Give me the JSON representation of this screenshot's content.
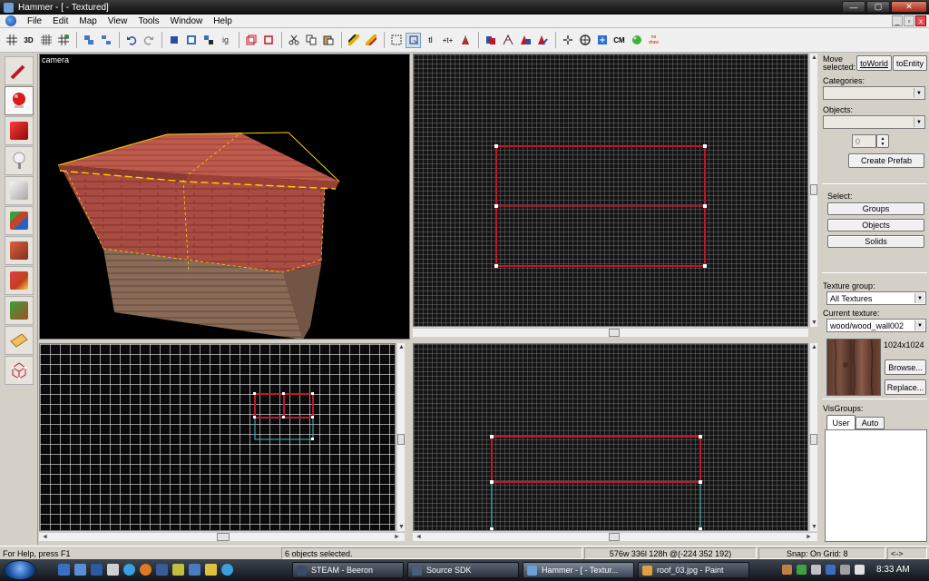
{
  "window": {
    "title": "Hammer - [ - Textured]"
  },
  "menu": [
    "File",
    "Edit",
    "Map",
    "View",
    "Tools",
    "Window",
    "Help"
  ],
  "mdi_buttons": {
    "minimize": "_",
    "restore": "▫",
    "close": "x"
  },
  "toolbar": {
    "label_3d": "3D",
    "label_tl": "tl",
    "label_cm": "CM",
    "label_no_draw": "no draw"
  },
  "viewports": {
    "camera_label": "camera"
  },
  "right_panel": {
    "move_selected_label": "Move selected:",
    "to_world_button": "toWorld",
    "to_entity_button": "toEntity",
    "categories_label": "Categories:",
    "objects_label": "Objects:",
    "quantity_value": "0",
    "create_prefab_button": "Create Prefab",
    "select_label": "Select:",
    "groups_button": "Groups",
    "objects_button": "Objects",
    "solids_button": "Solids",
    "texture_group_label": "Texture group:",
    "texture_group_value": "All Textures",
    "current_texture_label": "Current texture:",
    "current_texture_value": "wood/wood_wall002",
    "texture_size": "1024x1024",
    "browse_button": "Browse...",
    "replace_button": "Replace...",
    "visgroups_label": "VisGroups:",
    "tab_user": "User",
    "tab_auto": "Auto"
  },
  "statusbar": {
    "help": "For Help, press F1",
    "selection": "6 objects selected.",
    "dimensions": "576w 336l 128h @(-224 352 192)",
    "snap": "Snap: On Grid: 8",
    "arrows": "<->"
  },
  "taskbar": {
    "tasks": [
      {
        "label": "STEAM - Beeron",
        "icon_color": "#3b4c6b"
      },
      {
        "label": "Source SDK",
        "icon_color": "#4a5d7a"
      },
      {
        "label": "Hammer - [ - Textur...",
        "icon_color": "#6a9fd8"
      },
      {
        "label": "roof_03.jpg - Paint",
        "icon_color": "#e0a040"
      }
    ],
    "clock": "8:33 AM"
  },
  "colors": {
    "selection_red": "#c0162a",
    "wood_red": "#a44a3e",
    "vertex_white": "#ffffff",
    "accent_blue": "#cfe0f5"
  }
}
